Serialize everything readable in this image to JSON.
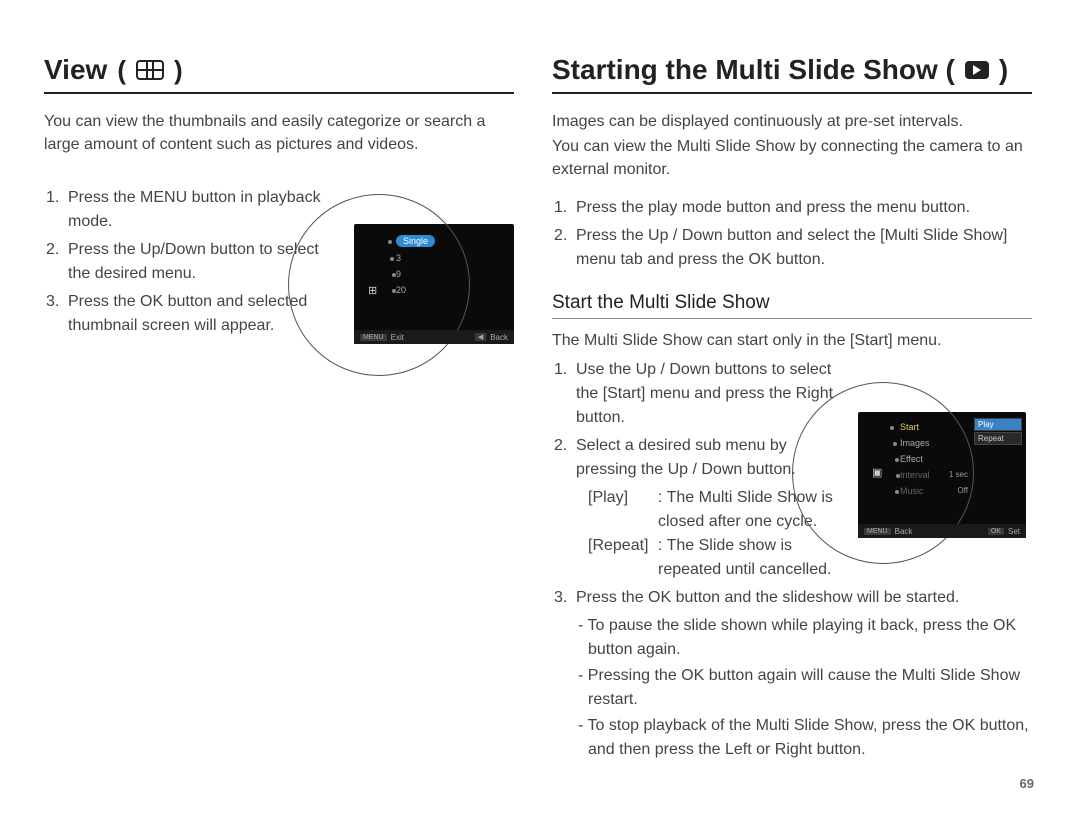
{
  "left": {
    "title": "View",
    "intro": "You can view the thumbnails and easily categorize or search a large amount of content such as pictures and videos.",
    "steps": [
      "Press the MENU button in playback mode.",
      "Press the Up/Down button to select the desired menu.",
      "Press the OK button and selected thumbnail screen will appear."
    ],
    "screen": {
      "highlight": "Single",
      "items": [
        "3",
        "9",
        "20"
      ],
      "side_icon": "⊞",
      "bar_left_tag": "MENU",
      "bar_left": "Exit",
      "bar_right_tag": "◀",
      "bar_right": "Back"
    }
  },
  "right": {
    "title": "Starting the Multi Slide Show (",
    "title_close": ")",
    "intro1": "Images can be displayed continuously at pre-set intervals.",
    "intro2": "You can view the Multi Slide Show by connecting the camera to an external monitor.",
    "steps_top": [
      "Press the play mode button and press the menu button.",
      "Press the Up / Down button and select the [Multi Slide Show] menu tab and press the OK button."
    ],
    "sub_heading": "Start the Multi Slide Show",
    "sub_intro": "The Multi Slide Show can start only in the [Start] menu.",
    "steps_sub": [
      "Use the Up / Down buttons to select the [Start] menu and press the Right button.",
      "Select a desired sub menu by pressing the Up / Down button."
    ],
    "defs": [
      {
        "k": "[Play]",
        "v": ": The Multi Slide Show is closed after one cycle."
      },
      {
        "k": "[Repeat]",
        "v": ": The Slide show is repeated until cancelled."
      }
    ],
    "step3": "Press the OK button and the slideshow will be started.",
    "dashes": [
      "To pause the slide shown while playing it back, press the OK button again.",
      "Pressing the OK button again will cause the Multi Slide Show restart.",
      "To stop playback of the Multi Slide Show, press the OK button, and then press the Left or Right button."
    ],
    "screen": {
      "menu_items": [
        "Start",
        "Images",
        "Effect",
        "Interval",
        "Music"
      ],
      "right_values": [
        "",
        "",
        "",
        "1 sec",
        "Off"
      ],
      "panel_items": [
        "Play",
        "Repeat"
      ],
      "panel_selected": "Play",
      "side_icon": "▣",
      "bar_left_tag": "MENU",
      "bar_left": "Back",
      "bar_right_tag": "OK",
      "bar_right": "Set"
    }
  },
  "page_number": "69"
}
